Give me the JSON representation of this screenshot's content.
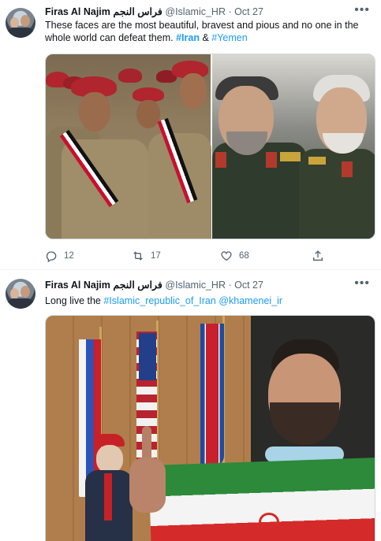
{
  "tweets": [
    {
      "author": {
        "name": "Firas Al Najim فراس النجم",
        "handle": "@Islamic_HR",
        "separator": "·",
        "time": "Oct 27"
      },
      "more_icon": "ellipsis-icon",
      "text_plain": "These faces are the most beautiful, bravest and pious and no one in the whole world can defeat them.",
      "hashtag1": "#Iran",
      "amp": "&",
      "hashtag2": "#Yemen",
      "actions": {
        "reply_count": "12",
        "retweet_count": "17",
        "like_count": "68"
      }
    },
    {
      "author": {
        "name": "Firas Al Najim فراس النجم",
        "handle": "@Islamic_HR",
        "separator": "·",
        "time": "Oct 27"
      },
      "more_icon": "ellipsis-icon",
      "text_plain": "Long live the",
      "hashtag1": "#Islamic_republic_of_Iran",
      "mention1": "@khamenei_ir"
    }
  ],
  "colors": {
    "link": "#1d9bf0",
    "secondary_text": "#536471",
    "divider": "#eff3f4"
  }
}
